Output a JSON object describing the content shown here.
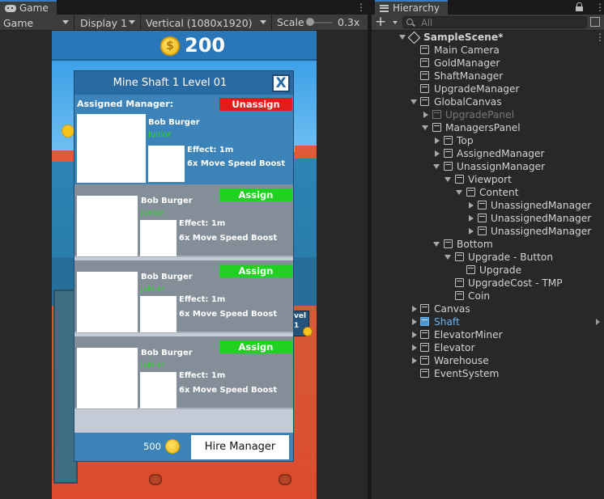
{
  "game": {
    "tab_label": "Game",
    "mode_label": "Game",
    "display_label": "Display 1",
    "resolution_label": "Vertical (1080x1920)",
    "scale_label": "Scale",
    "scale_value": "0.3x",
    "scale_fraction": 0.3
  },
  "game_view": {
    "gold_amount": "200",
    "level_badge": "vel\n1"
  },
  "manager_panel": {
    "title": "Mine Shaft 1 Level 01",
    "close_label": "X",
    "assigned_label": "Assigned Manager:",
    "unassign_label": "Unassign",
    "assigned": {
      "name": "Bob Burger",
      "rank": "Junior",
      "effect": "Effect: 1m",
      "boost": "6x Move Speed Boost"
    },
    "unassigned": [
      {
        "name": "Bob Burger",
        "rank": "Junior",
        "effect": "Effect: 1m",
        "boost": "6x Move Speed Boost",
        "assign_label": "Assign"
      },
      {
        "name": "Bob Burger",
        "rank": "Junior",
        "effect": "Effect: 1m",
        "boost": "6x Move Speed Boost",
        "assign_label": "Assign"
      },
      {
        "name": "Bob Burger",
        "rank": "Junior",
        "effect": "Effect: 1m",
        "boost": "6x Move Speed Boost",
        "assign_label": "Assign"
      }
    ],
    "hire_cost": "500",
    "hire_label": "Hire Manager"
  },
  "hierarchy": {
    "tab_label": "Hierarchy",
    "search_placeholder": "All",
    "items": [
      {
        "label": "SampleScene*"
      },
      {
        "label": "Main Camera"
      },
      {
        "label": "GoldManager"
      },
      {
        "label": "ShaftManager"
      },
      {
        "label": "UpgradeManager"
      },
      {
        "label": "GlobalCanvas"
      },
      {
        "label": "UpgradePanel"
      },
      {
        "label": "ManagersPanel"
      },
      {
        "label": "Top"
      },
      {
        "label": "AssignedManager"
      },
      {
        "label": "UnassignManager"
      },
      {
        "label": "Viewport"
      },
      {
        "label": "Content"
      },
      {
        "label": "UnassignedManager"
      },
      {
        "label": "UnassignedManager"
      },
      {
        "label": "UnassignedManager"
      },
      {
        "label": "Bottom"
      },
      {
        "label": "Upgrade - Button"
      },
      {
        "label": "Upgrade"
      },
      {
        "label": "UpgradeCost - TMP"
      },
      {
        "label": "Coin"
      },
      {
        "label": "Canvas"
      },
      {
        "label": "Shaft"
      },
      {
        "label": "ElevatorMiner"
      },
      {
        "label": "Elevator"
      },
      {
        "label": "Warehouse"
      },
      {
        "label": "EventSystem"
      }
    ]
  },
  "colors": {
    "accent": "#3a79bb",
    "unassign": "#e21b1b",
    "assign": "#21d121",
    "rank": "#2bd92b",
    "selected_object": "#6cb3ec"
  }
}
